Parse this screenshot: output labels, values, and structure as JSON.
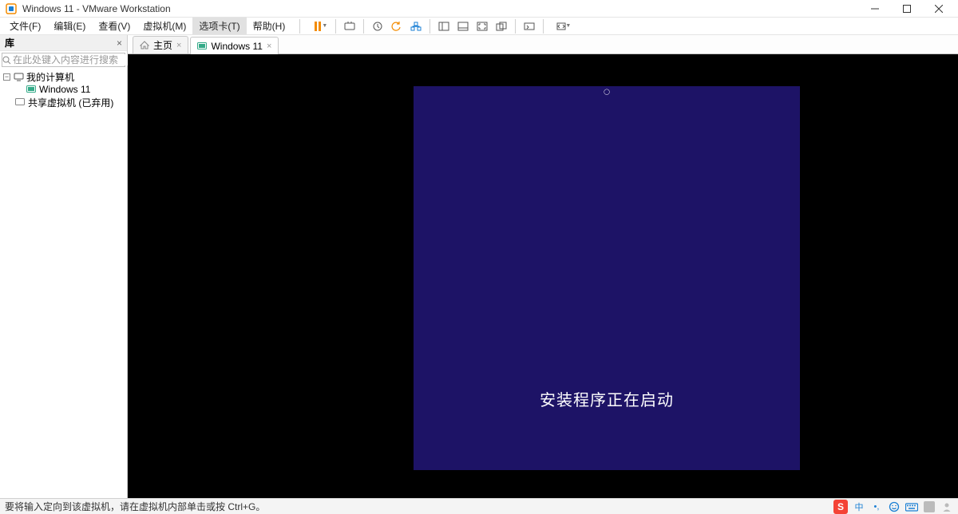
{
  "titlebar": {
    "title": "Windows 11 - VMware Workstation"
  },
  "menubar": {
    "file": "文件(F)",
    "edit": "编辑(E)",
    "view": "查看(V)",
    "vm": "虚拟机(M)",
    "tabs": "选项卡(T)",
    "help": "帮助(H)"
  },
  "sidebar": {
    "header": "库",
    "search_placeholder": "在此处键入内容进行搜索",
    "tree": {
      "root": "我的计算机",
      "vm1": "Windows 11",
      "shared": "共享虚拟机 (已弃用)"
    }
  },
  "tabs": {
    "home": "主页",
    "vm": "Windows 11"
  },
  "guest": {
    "setup_text": "安装程序正在启动"
  },
  "statusbar": {
    "hint": "要将输入定向到该虚拟机，请在虚拟机内部单击或按 Ctrl+G。",
    "ime": "中"
  }
}
